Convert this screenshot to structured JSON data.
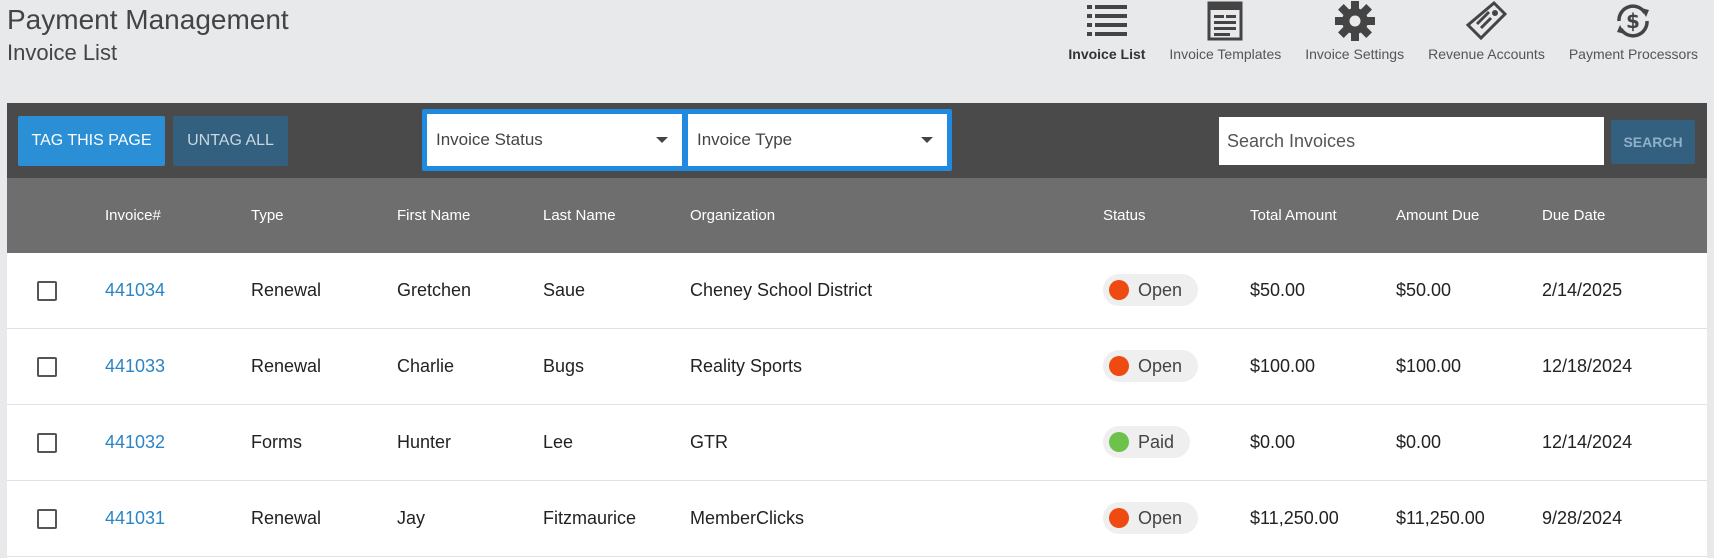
{
  "header": {
    "title": "Payment Management",
    "subtitle": "Invoice List"
  },
  "nav": [
    {
      "label": "Invoice List",
      "icon": "list-icon",
      "active": true
    },
    {
      "label": "Invoice Templates",
      "icon": "template-icon",
      "active": false
    },
    {
      "label": "Invoice Settings",
      "icon": "gear-icon",
      "active": false
    },
    {
      "label": "Revenue Accounts",
      "icon": "tag-icon",
      "active": false
    },
    {
      "label": "Payment Processors",
      "icon": "dollar-refresh-icon",
      "active": false
    }
  ],
  "toolbar": {
    "tag_label": "TAG THIS PAGE",
    "untag_label": "UNTAG ALL",
    "status_filter": "Invoice Status",
    "type_filter": "Invoice Type",
    "search_placeholder": "Search Invoices",
    "search_label": "SEARCH"
  },
  "table": {
    "columns": [
      "Invoice#",
      "Type",
      "First Name",
      "Last Name",
      "Organization",
      "Status",
      "Total Amount",
      "Amount Due",
      "Due Date"
    ],
    "rows": [
      {
        "invoice": "441034",
        "type": "Renewal",
        "first": "Gretchen",
        "last": "Saue",
        "org": "Cheney School District",
        "status": "Open",
        "total": "$50.00",
        "due": "$50.00",
        "date": "2/14/2025"
      },
      {
        "invoice": "441033",
        "type": "Renewal",
        "first": "Charlie",
        "last": "Bugs",
        "org": "Reality Sports",
        "status": "Open",
        "total": "$100.00",
        "due": "$100.00",
        "date": "12/18/2024"
      },
      {
        "invoice": "441032",
        "type": "Forms",
        "first": "Hunter",
        "last": "Lee",
        "org": "GTR",
        "status": "Paid",
        "total": "$0.00",
        "due": "$0.00",
        "date": "12/14/2024"
      },
      {
        "invoice": "441031",
        "type": "Renewal",
        "first": "Jay",
        "last": "Fitzmaurice",
        "org": "MemberClicks",
        "status": "Open",
        "total": "$11,250.00",
        "due": "$11,250.00",
        "date": "9/28/2024"
      }
    ]
  },
  "colors": {
    "open": "#ee4a12",
    "paid": "#6cc24a",
    "accent": "#2b8fd6"
  }
}
